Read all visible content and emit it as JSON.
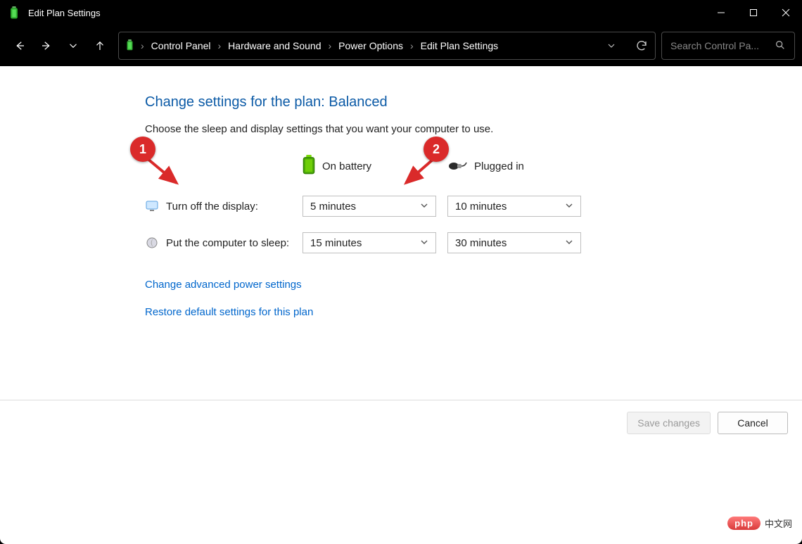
{
  "window": {
    "title": "Edit Plan Settings"
  },
  "breadcrumb": {
    "items": [
      "Control Panel",
      "Hardware and Sound",
      "Power Options",
      "Edit Plan Settings"
    ]
  },
  "search": {
    "placeholder": "Search Control Pa..."
  },
  "page": {
    "heading": "Change settings for the plan: Balanced",
    "subheading": "Choose the sleep and display settings that you want your computer to use.",
    "columns": {
      "battery": "On battery",
      "plugged": "Plugged in"
    },
    "rows": [
      {
        "label": "Turn off the display:",
        "battery": "5 minutes",
        "plugged": "10 minutes"
      },
      {
        "label": "Put the computer to sleep:",
        "battery": "15 minutes",
        "plugged": "30 minutes"
      }
    ],
    "links": {
      "advanced": "Change advanced power settings",
      "restore": "Restore default settings for this plan"
    },
    "buttons": {
      "save": "Save changes",
      "cancel": "Cancel"
    }
  },
  "annotations": {
    "b1": "1",
    "b2": "2"
  },
  "watermark": {
    "pill": "php",
    "text": "中文网"
  }
}
